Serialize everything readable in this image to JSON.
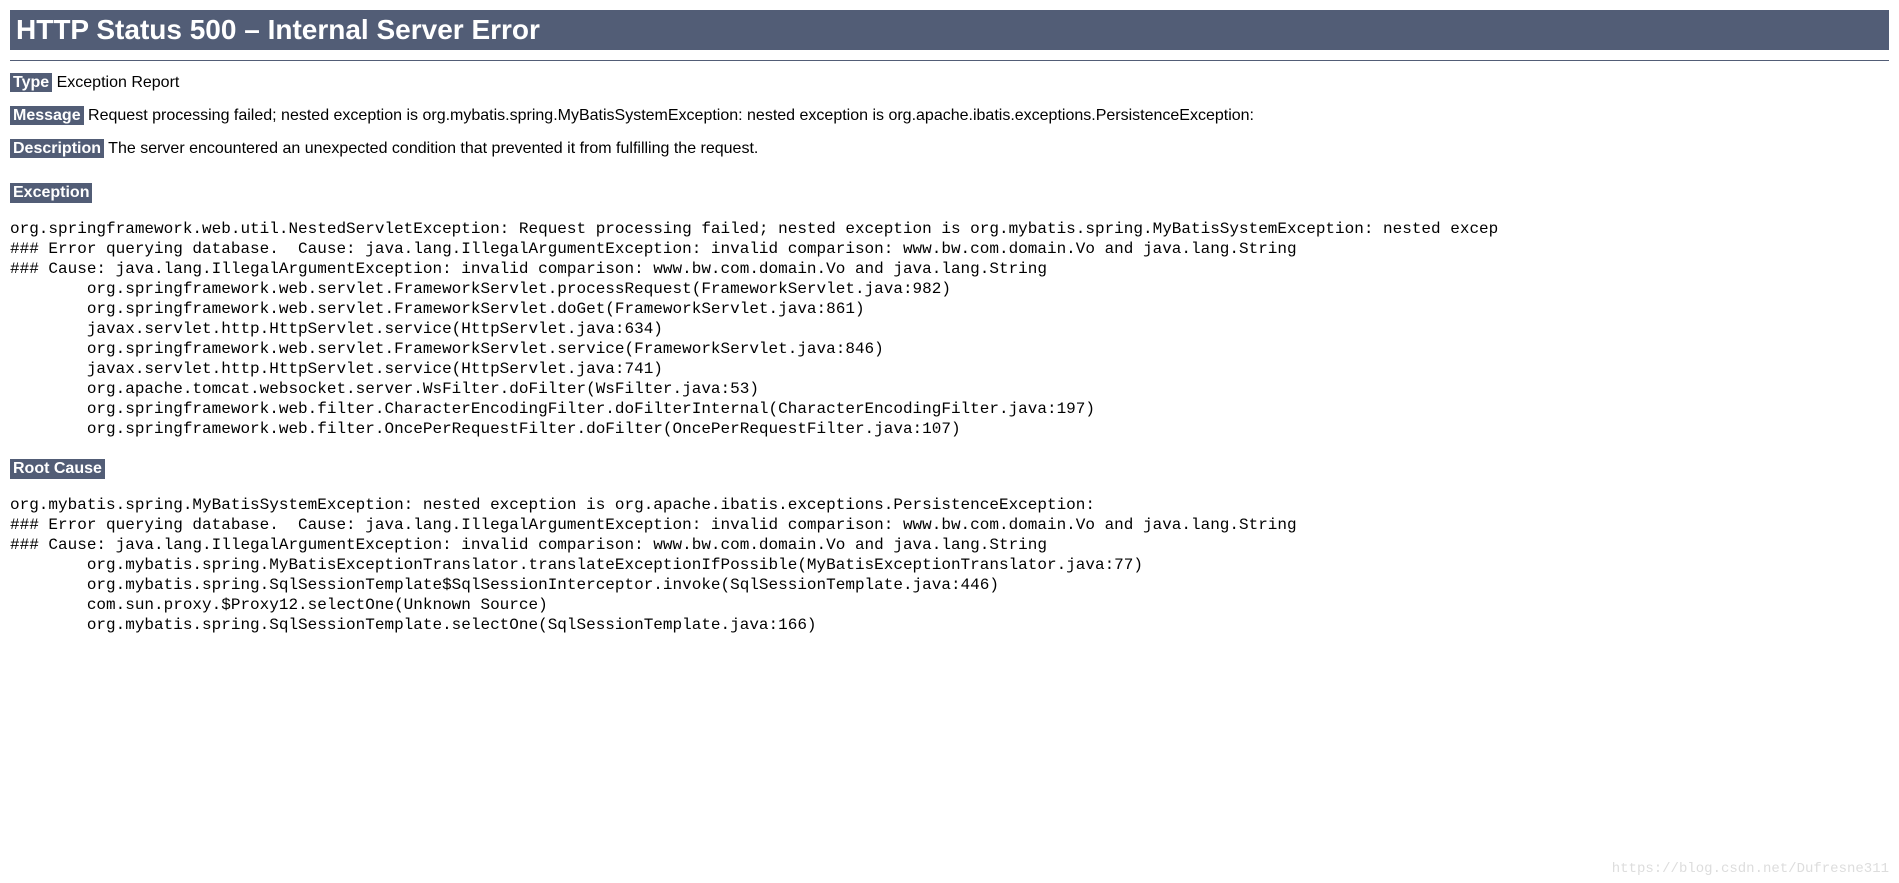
{
  "title": "HTTP Status 500 – Internal Server Error",
  "type": {
    "label": "Type",
    "value": "Exception Report"
  },
  "message": {
    "label": "Message",
    "value": "Request processing failed; nested exception is org.mybatis.spring.MyBatisSystemException: nested exception is org.apache.ibatis.exceptions.PersistenceException:"
  },
  "description": {
    "label": "Description",
    "value": "The server encountered an unexpected condition that prevented it from fulfilling the request."
  },
  "exception": {
    "label": "Exception",
    "trace": "org.springframework.web.util.NestedServletException: Request processing failed; nested exception is org.mybatis.spring.MyBatisSystemException: nested excep\n### Error querying database.  Cause: java.lang.IllegalArgumentException: invalid comparison: www.bw.com.domain.Vo and java.lang.String\n### Cause: java.lang.IllegalArgumentException: invalid comparison: www.bw.com.domain.Vo and java.lang.String\n\torg.springframework.web.servlet.FrameworkServlet.processRequest(FrameworkServlet.java:982)\n\torg.springframework.web.servlet.FrameworkServlet.doGet(FrameworkServlet.java:861)\n\tjavax.servlet.http.HttpServlet.service(HttpServlet.java:634)\n\torg.springframework.web.servlet.FrameworkServlet.service(FrameworkServlet.java:846)\n\tjavax.servlet.http.HttpServlet.service(HttpServlet.java:741)\n\torg.apache.tomcat.websocket.server.WsFilter.doFilter(WsFilter.java:53)\n\torg.springframework.web.filter.CharacterEncodingFilter.doFilterInternal(CharacterEncodingFilter.java:197)\n\torg.springframework.web.filter.OncePerRequestFilter.doFilter(OncePerRequestFilter.java:107)"
  },
  "rootCause": {
    "label": "Root Cause",
    "trace": "org.mybatis.spring.MyBatisSystemException: nested exception is org.apache.ibatis.exceptions.PersistenceException: \n### Error querying database.  Cause: java.lang.IllegalArgumentException: invalid comparison: www.bw.com.domain.Vo and java.lang.String\n### Cause: java.lang.IllegalArgumentException: invalid comparison: www.bw.com.domain.Vo and java.lang.String\n\torg.mybatis.spring.MyBatisExceptionTranslator.translateExceptionIfPossible(MyBatisExceptionTranslator.java:77)\n\torg.mybatis.spring.SqlSessionTemplate$SqlSessionInterceptor.invoke(SqlSessionTemplate.java:446)\n\tcom.sun.proxy.$Proxy12.selectOne(Unknown Source)\n\torg.mybatis.spring.SqlSessionTemplate.selectOne(SqlSessionTemplate.java:166)"
  },
  "watermark": "https://blog.csdn.net/Dufresne311"
}
